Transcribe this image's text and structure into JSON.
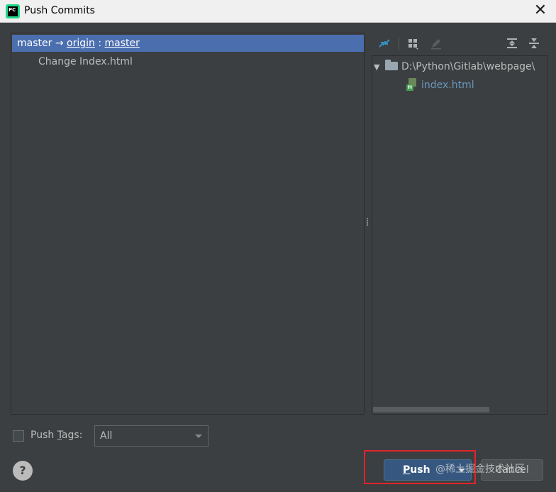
{
  "window": {
    "title": "Push Commits",
    "app_icon": "pycharm-icon",
    "close_glyph": "✕",
    "app_icon_text": "PC"
  },
  "branch": {
    "local": "master",
    "arrow": "→",
    "remote": "origin",
    "separator": ":",
    "remote_branch": "master"
  },
  "commits": [
    {
      "message": "Change Index.html"
    }
  ],
  "toolbar": {
    "icons": [
      "expand-arrows-icon",
      "group-by-icon",
      "edit-icon",
      "expand-all-icon",
      "collapse-all-icon"
    ]
  },
  "tree": {
    "root_path": "D:\\Python\\Gitlab\\webpage\\",
    "files": [
      {
        "name": "index.html",
        "icon": "html-file-icon",
        "color": "#6897bb"
      }
    ]
  },
  "push_tags": {
    "label_prefix": "Push ",
    "label_mnemonic": "T",
    "label_suffix": "ags:",
    "checked": false,
    "selected_option": "All"
  },
  "buttons": {
    "help": "?",
    "push_mnemonic": "P",
    "push_rest": "ush",
    "cancel": "Cancel"
  },
  "watermark": "@稀土掘金技术社区",
  "colors": {
    "selection": "#4b6eaf",
    "push_button": "#365880",
    "highlight_box": "#e0242c"
  }
}
